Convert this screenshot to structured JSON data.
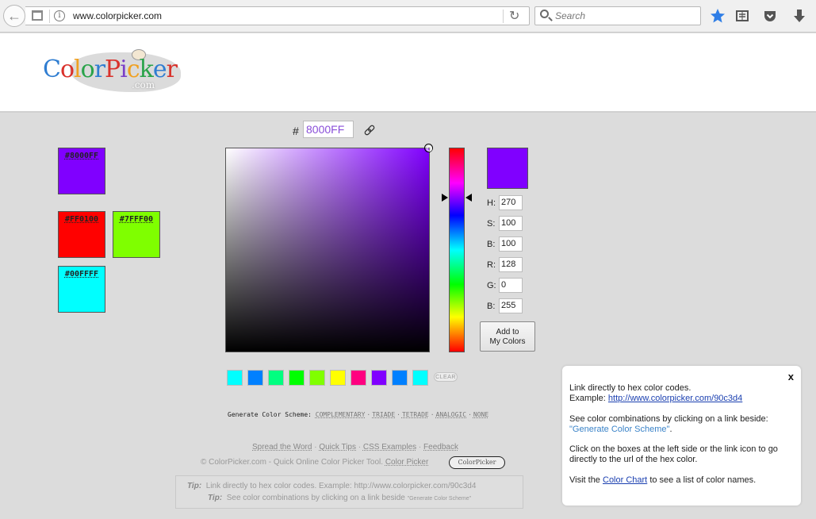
{
  "browser": {
    "url": "www.colorpicker.com",
    "search_placeholder": "Search"
  },
  "logo": {
    "letters": [
      "C",
      "o",
      "l",
      "o",
      "r",
      "P",
      "i",
      "c",
      "k",
      "e",
      "r"
    ],
    "letter_colors": [
      "#2f7dd1",
      "#d9312b",
      "#f0a020",
      "#2aa34a",
      "#2f7dd1",
      "#d9312b",
      "#7a3fc8",
      "#f0a020",
      "#2aa34a",
      "#2f7dd1",
      "#d9312b"
    ],
    "dotcom": ".com"
  },
  "saved_colors": [
    {
      "hex": "#8000FF",
      "label": "#8000FF"
    },
    {
      "hex": "#FF0100",
      "label": "#FF0100"
    },
    {
      "hex": "#7FFF00",
      "label": "#7FFF00"
    },
    {
      "hex": "#00FFFF",
      "label": "#00FFFF"
    }
  ],
  "picker": {
    "hash": "#",
    "hex_value": "8000FF",
    "current_color": "#8000FF",
    "hue_marker": 0.25,
    "fields": [
      {
        "label": "H:",
        "value": "270"
      },
      {
        "label": "S:",
        "value": "100"
      },
      {
        "label": "B:",
        "value": "100"
      },
      {
        "label": "R:",
        "value": "128"
      },
      {
        "label": "G:",
        "value": "0"
      },
      {
        "label": "B:",
        "value": "255"
      }
    ],
    "add_button_line1": "Add to",
    "add_button_line2": "My Colors"
  },
  "history": {
    "colors": [
      "#00FFFF",
      "#0080FF",
      "#00FF80",
      "#00FF00",
      "#80FF00",
      "#FFFF00",
      "#FF0080",
      "#8000FF",
      "#0080FF",
      "#00FFFF"
    ],
    "clear_label": "CLEAR"
  },
  "scheme": {
    "label": "Generate Color Scheme:",
    "options": [
      "COMPLEMENTARY",
      "TRIADE",
      "TETRADE",
      "ANALOGIC",
      "NONE"
    ]
  },
  "footer": {
    "links": [
      "Spread the Word",
      "Quick Tips",
      "CSS Examples",
      "Feedback"
    ],
    "copyright": "© ColorPicker.com - Quick Online Color Picker Tool.",
    "copyright_link": "Color Picker",
    "badge": "ColorPicker",
    "tip1_label": "Tip:",
    "tip1_text": "Link directly to hex color codes.   Example: http://www.colorpicker.com/90c3d4",
    "tip2_label": "Tip:",
    "tip2_text": "See color combinations by clicking on a link beside",
    "tip2_small": "\"Generate Color Scheme\""
  },
  "panel": {
    "close": "x",
    "p1_line1": "Link directly to hex color codes.",
    "p1_example": "Example:",
    "p1_link": "http://www.colorpicker.com/90c3d4",
    "p2_text": "See color combinations by clicking on a link beside:",
    "p2_link": "\"Generate Color Scheme\"",
    "p3_text": "Click on the boxes at the left side or the link icon to go directly to the url of the hex color.",
    "p4_pre": "Visit the",
    "p4_link": "Color Chart",
    "p4_post": "to see a list of color names."
  }
}
